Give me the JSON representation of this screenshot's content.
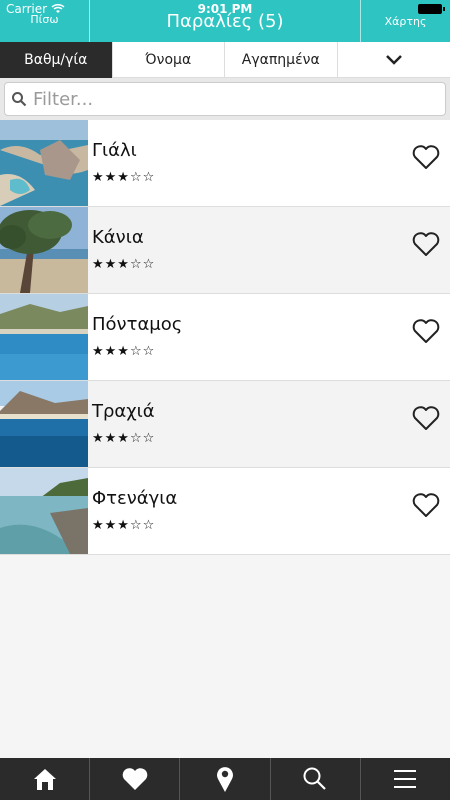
{
  "status": {
    "carrier": "Carrier",
    "time": "9:01 PM"
  },
  "nav": {
    "back": "Πίσω",
    "title": "Παραλίες (5)",
    "map": "Χάρτης"
  },
  "tabs": [
    {
      "label": "Βαθμ/γία"
    },
    {
      "label": "Όνομα"
    },
    {
      "label": "Αγαπημένα"
    }
  ],
  "search": {
    "placeholder": "Filter...",
    "value": ""
  },
  "beaches": [
    {
      "name": "Γιάλι",
      "rating": 3,
      "stars": "★★★☆☆"
    },
    {
      "name": "Κάνια",
      "rating": 3,
      "stars": "★★★☆☆"
    },
    {
      "name": "Πόνταμος",
      "rating": 3,
      "stars": "★★★☆☆"
    },
    {
      "name": "Τραχιά",
      "rating": 3,
      "stars": "★★★☆☆"
    },
    {
      "name": "Φτενάγια",
      "rating": 3,
      "stars": "★★★☆☆"
    }
  ],
  "tabbar": [
    {
      "icon": "home-icon"
    },
    {
      "icon": "heart-icon"
    },
    {
      "icon": "location-pin-icon"
    },
    {
      "icon": "search-icon"
    },
    {
      "icon": "menu-icon"
    }
  ],
  "colors": {
    "accent": "#2ec4c2",
    "dark": "#2b2b2b"
  }
}
